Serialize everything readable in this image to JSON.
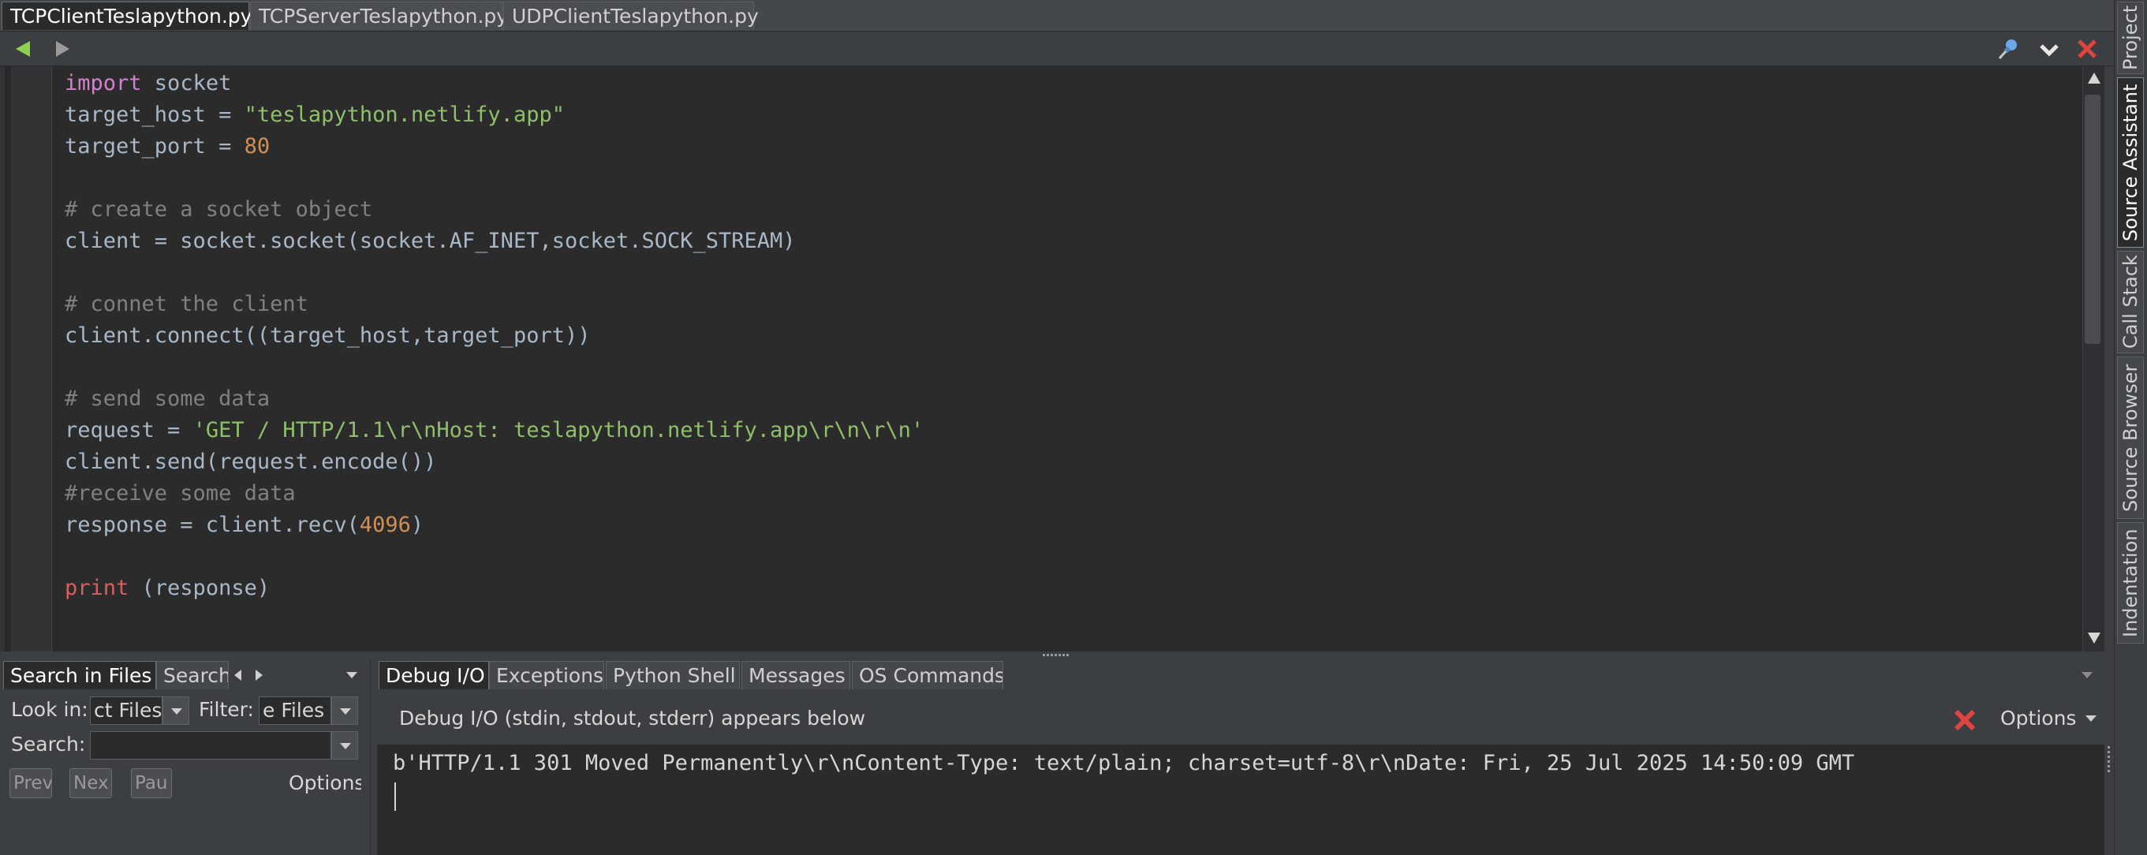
{
  "editor_tabs": [
    {
      "label": "TCPClientTeslapython.py",
      "active": true
    },
    {
      "label": "TCPServerTeslapython.py",
      "active": false
    },
    {
      "label": "UDPClientTeslapython.py",
      "active": false
    }
  ],
  "code_lines": [
    [
      {
        "t": "import",
        "c": "kw"
      },
      {
        "t": " socket",
        "c": ""
      }
    ],
    [
      {
        "t": "target_host = ",
        "c": ""
      },
      {
        "t": "\"teslapython.netlify.app\"",
        "c": "str"
      }
    ],
    [
      {
        "t": "target_port = ",
        "c": ""
      },
      {
        "t": "80",
        "c": "num"
      }
    ],
    [],
    [
      {
        "t": "# create a socket object",
        "c": "cm"
      }
    ],
    [
      {
        "t": "client = socket.socket(socket.AF_INET,socket.SOCK_STREAM)",
        "c": ""
      }
    ],
    [],
    [
      {
        "t": "# connet the client",
        "c": "cm"
      }
    ],
    [
      {
        "t": "client.connect((target_host,target_port))",
        "c": ""
      }
    ],
    [],
    [
      {
        "t": "# send some data",
        "c": "cm"
      }
    ],
    [
      {
        "t": "request = ",
        "c": ""
      },
      {
        "t": "'GET / HTTP/1.1\\r\\nHost: teslapython.netlify.app\\r\\n\\r\\n'",
        "c": "str"
      }
    ],
    [
      {
        "t": "client.send(request.encode())",
        "c": ""
      }
    ],
    [
      {
        "t": "#receive some data",
        "c": "cm"
      }
    ],
    [
      {
        "t": "response = client.recv(",
        "c": ""
      },
      {
        "t": "4096",
        "c": "num"
      },
      {
        "t": ")",
        "c": ""
      }
    ],
    [],
    [
      {
        "t": "print",
        "c": "pr"
      },
      {
        "t": " (response)",
        "c": ""
      }
    ]
  ],
  "right_tabs": [
    {
      "label": "Project",
      "active": false
    },
    {
      "label": "Source Assistant",
      "active": true
    },
    {
      "label": "Call Stack",
      "active": false
    },
    {
      "label": "Source Browser",
      "active": false
    },
    {
      "label": "Indentation",
      "active": false
    }
  ],
  "search_panel": {
    "tabs": [
      "Search in Files",
      "Search"
    ],
    "look_in_label": "Look in:",
    "look_in_value": "ct Files",
    "filter_label": "Filter:",
    "filter_value": "e Files",
    "search_label": "Search:",
    "search_value": "",
    "prev_label": "Previ",
    "next_label": "Nex",
    "pause_label": "Pau",
    "options_label": "Options"
  },
  "debug_panel": {
    "tabs": [
      "Debug I/O",
      "Exceptions",
      "Python Shell",
      "Messages",
      "OS Commands"
    ],
    "header_text": "Debug I/O (stdin, stdout, stderr) appears below",
    "options_label": "Options",
    "output_line": "b'HTTP/1.1 301 Moved Permanently\\r\\nContent-Type: text/plain; charset=utf-8\\r\\nDate: Fri, 25 Jul 2025 14:50:09 GMT"
  },
  "colors": {
    "keyword": "#d47fd0",
    "string": "#8fbf6a",
    "number": "#d18e55",
    "comment": "#7f8180",
    "builtin": "#d75f5f",
    "close_red": "#e0443e",
    "nav_green": "#8fd14f"
  }
}
